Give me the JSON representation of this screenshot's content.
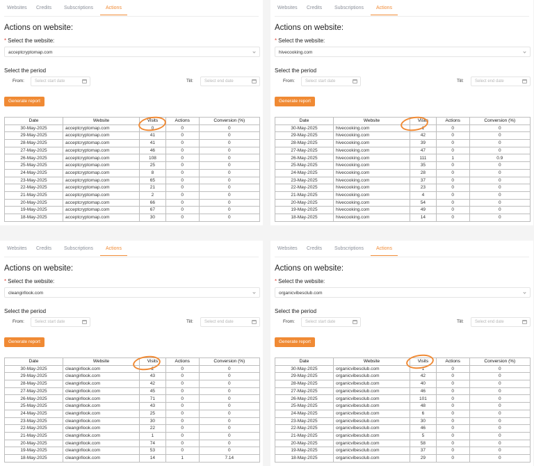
{
  "tabs": [
    "Websites",
    "Credits",
    "Subscriptions",
    "Actions"
  ],
  "active_tab": "Actions",
  "page_title": "Actions on website:",
  "select_label": "Select the website:",
  "period_label": "Select the period",
  "from_label": "From:",
  "till_label": "Till:",
  "start_placeholder": "Select start date",
  "end_placeholder": "Select end date",
  "generate_label": "Generate report",
  "table_headers": [
    "Date",
    "Website",
    "Visits",
    "Actions",
    "Conversion (%)"
  ],
  "accent_color": "#f08a34",
  "required_color": "#e0463a",
  "panels": [
    {
      "website": "acceptcryptomap.com",
      "rows": [
        [
          "30-May-2025",
          "acceptcryptomap.com",
          "0",
          "0",
          "0"
        ],
        [
          "29-May-2025",
          "acceptcryptomap.com",
          "41",
          "0",
          "0"
        ],
        [
          "28-May-2025",
          "acceptcryptomap.com",
          "41",
          "0",
          "0"
        ],
        [
          "27-May-2025",
          "acceptcryptomap.com",
          "46",
          "0",
          "0"
        ],
        [
          "26-May-2025",
          "acceptcryptomap.com",
          "108",
          "0",
          "0"
        ],
        [
          "25-May-2025",
          "acceptcryptomap.com",
          "25",
          "0",
          "0"
        ],
        [
          "24-May-2025",
          "acceptcryptomap.com",
          "8",
          "0",
          "0"
        ],
        [
          "23-May-2025",
          "acceptcryptomap.com",
          "65",
          "0",
          "0"
        ],
        [
          "22-May-2025",
          "acceptcryptomap.com",
          "21",
          "0",
          "0"
        ],
        [
          "21-May-2025",
          "acceptcryptomap.com",
          "2",
          "0",
          "0"
        ],
        [
          "20-May-2025",
          "acceptcryptomap.com",
          "66",
          "0",
          "0"
        ],
        [
          "19-May-2025",
          "acceptcryptomap.com",
          "67",
          "0",
          "0"
        ],
        [
          "18-May-2025",
          "acceptcryptomap.com",
          "30",
          "0",
          "0"
        ]
      ]
    },
    {
      "website": "hivecooking.com",
      "rows": [
        [
          "30-May-2025",
          "hivecooking.com",
          "1",
          "0",
          "0"
        ],
        [
          "29-May-2025",
          "hivecooking.com",
          "42",
          "0",
          "0"
        ],
        [
          "28-May-2025",
          "hivecooking.com",
          "39",
          "0",
          "0"
        ],
        [
          "27-May-2025",
          "hivecooking.com",
          "47",
          "0",
          "0"
        ],
        [
          "26-May-2025",
          "hivecooking.com",
          "111",
          "1",
          "0.9"
        ],
        [
          "25-May-2025",
          "hivecooking.com",
          "35",
          "0",
          "0"
        ],
        [
          "24-May-2025",
          "hivecooking.com",
          "28",
          "0",
          "0"
        ],
        [
          "23-May-2025",
          "hivecooking.com",
          "37",
          "0",
          "0"
        ],
        [
          "22-May-2025",
          "hivecooking.com",
          "23",
          "0",
          "0"
        ],
        [
          "21-May-2025",
          "hivecooking.com",
          "4",
          "0",
          "0"
        ],
        [
          "20-May-2025",
          "hivecooking.com",
          "54",
          "0",
          "0"
        ],
        [
          "19-May-2025",
          "hivecooking.com",
          "49",
          "0",
          "0"
        ],
        [
          "18-May-2025",
          "hivecooking.com",
          "14",
          "0",
          "0"
        ]
      ]
    },
    {
      "website": "cleangirllook.com",
      "rows": [
        [
          "30-May-2025",
          "cleangirllook.com",
          "2",
          "0",
          "0"
        ],
        [
          "29-May-2025",
          "cleangirllook.com",
          "43",
          "0",
          "0"
        ],
        [
          "28-May-2025",
          "cleangirllook.com",
          "42",
          "0",
          "0"
        ],
        [
          "27-May-2025",
          "cleangirllook.com",
          "45",
          "0",
          "0"
        ],
        [
          "26-May-2025",
          "cleangirllook.com",
          "71",
          "0",
          "0"
        ],
        [
          "25-May-2025",
          "cleangirllook.com",
          "43",
          "0",
          "0"
        ],
        [
          "24-May-2025",
          "cleangirllook.com",
          "25",
          "0",
          "0"
        ],
        [
          "23-May-2025",
          "cleangirllook.com",
          "30",
          "0",
          "0"
        ],
        [
          "22-May-2025",
          "cleangirllook.com",
          "22",
          "0",
          "0"
        ],
        [
          "21-May-2025",
          "cleangirllook.com",
          "1",
          "0",
          "0"
        ],
        [
          "20-May-2025",
          "cleangirllook.com",
          "74",
          "0",
          "0"
        ],
        [
          "19-May-2025",
          "cleangirllook.com",
          "53",
          "0",
          "0"
        ],
        [
          "18-May-2025",
          "cleangirllook.com",
          "14",
          "1",
          "7.14"
        ]
      ]
    },
    {
      "website": "organicvibesclub.com",
      "rows": [
        [
          "30-May-2025",
          "organicvibesclub.com",
          "1",
          "0",
          "0"
        ],
        [
          "29-May-2025",
          "organicvibesclub.com",
          "42",
          "0",
          "0"
        ],
        [
          "28-May-2025",
          "organicvibesclub.com",
          "40",
          "0",
          "0"
        ],
        [
          "27-May-2025",
          "organicvibesclub.com",
          "46",
          "0",
          "0"
        ],
        [
          "26-May-2025",
          "organicvibesclub.com",
          "101",
          "0",
          "0"
        ],
        [
          "25-May-2025",
          "organicvibesclub.com",
          "48",
          "0",
          "0"
        ],
        [
          "24-May-2025",
          "organicvibesclub.com",
          "6",
          "0",
          "0"
        ],
        [
          "23-May-2025",
          "organicvibesclub.com",
          "30",
          "0",
          "0"
        ],
        [
          "22-May-2025",
          "organicvibesclub.com",
          "46",
          "0",
          "0"
        ],
        [
          "21-May-2025",
          "organicvibesclub.com",
          "5",
          "0",
          "0"
        ],
        [
          "20-May-2025",
          "organicvibesclub.com",
          "58",
          "0",
          "0"
        ],
        [
          "19-May-2025",
          "organicvibesclub.com",
          "37",
          "0",
          "0"
        ],
        [
          "18-May-2025",
          "organicvibesclub.com",
          "29",
          "0",
          "0"
        ]
      ]
    }
  ]
}
